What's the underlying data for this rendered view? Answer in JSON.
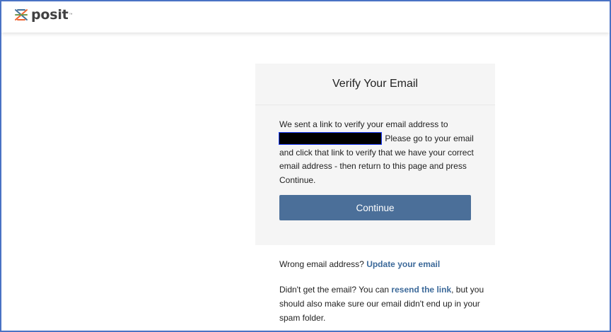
{
  "header": {
    "brand": "posit",
    "trademark": "™",
    "logo_icon": "posit-logo-icon"
  },
  "card": {
    "title": "Verify Your Email",
    "message_prefix": "We sent a link to verify your email address to",
    "message_suffix": "Please go to your email and click that link to verify that we have your correct email address - then return to this page and press Continue.",
    "continue_label": "Continue"
  },
  "help": {
    "wrong_email_prefix": "Wrong email address?",
    "update_email_link": "Update your email",
    "not_received_prefix": "Didn't get the email? You can",
    "resend_link": "resend the link",
    "not_received_suffix": ", but you should also make sure our email didn't end up in your spam folder."
  },
  "colors": {
    "accent": "#4b6f99",
    "link": "#3d6a9a",
    "frame_border": "#4a72c4",
    "card_bg": "#f5f5f5"
  }
}
